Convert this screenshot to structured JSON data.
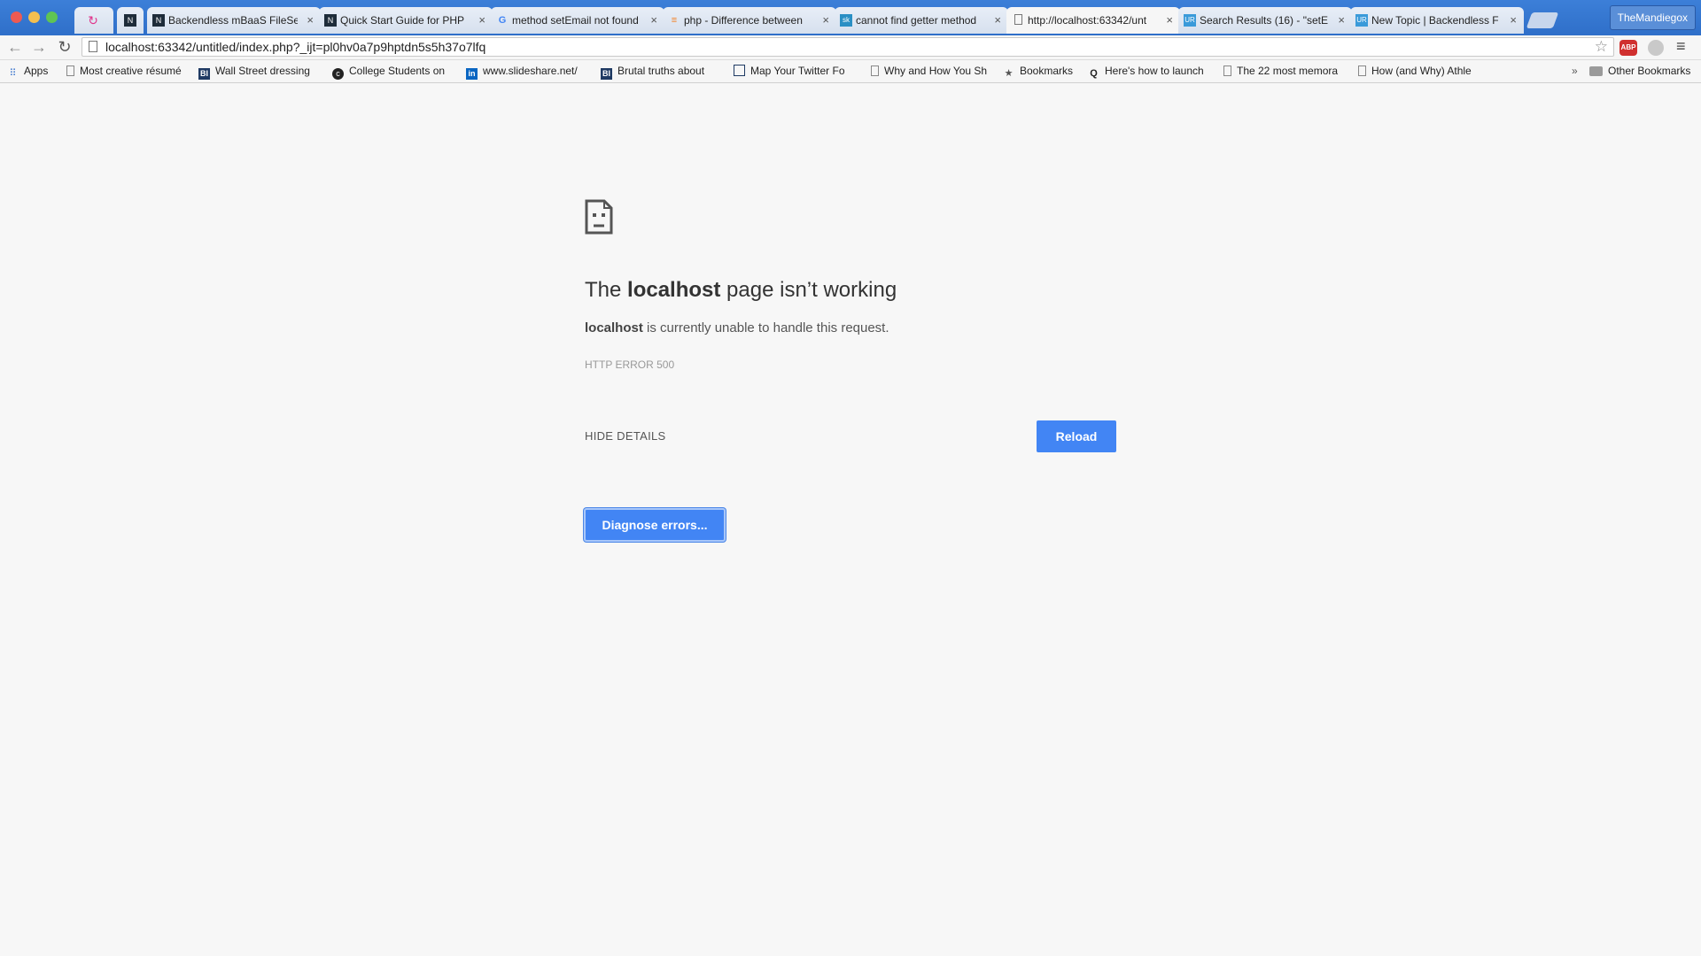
{
  "browser": {
    "tabs": [
      {
        "title": "",
        "favicon": "reload-spinner-icon",
        "active": false
      },
      {
        "title": "Backendless mBaaS FileSe",
        "favicon": "backendless-icon",
        "active": false
      },
      {
        "title": "Quick Start Guide for PHP",
        "favicon": "backendless-icon",
        "active": false
      },
      {
        "title": "method setEmail not found",
        "favicon": "google-icon",
        "active": false
      },
      {
        "title": "php - Difference between",
        "favicon": "stackoverflow-icon",
        "active": false
      },
      {
        "title": "cannot find getter method",
        "favicon": "site-icon",
        "active": false
      },
      {
        "title": "http://localhost:63342/unt",
        "favicon": "page-icon",
        "active": true
      },
      {
        "title": "Search Results (16) - \"setE",
        "favicon": "uservoice-icon",
        "active": false
      },
      {
        "title": "New Topic | Backendless F",
        "favicon": "uservoice-icon",
        "active": false
      }
    ],
    "profile_name": "TheMandiegox",
    "url": "localhost:63342/untitled/index.php?_ijt=pl0hv0a7p9hptdn5s5h37o7lfq",
    "bookmarks": [
      {
        "label": "Apps",
        "icon": "apps-grid-icon"
      },
      {
        "label": "Most creative résumé",
        "icon": "page-icon"
      },
      {
        "label": "Wall Street dressing",
        "icon": "business-insider-icon"
      },
      {
        "label": "College Students on",
        "icon": "site-icon"
      },
      {
        "label": "www.slideshare.net/",
        "icon": "linkedin-icon"
      },
      {
        "label": "Brutal truths about",
        "icon": "business-insider-icon"
      },
      {
        "label": "Map Your Twitter Fo",
        "icon": "site-icon"
      },
      {
        "label": "Why and How You Sh",
        "icon": "page-icon"
      },
      {
        "label": "Bookmarks",
        "icon": "star-icon"
      },
      {
        "label": "Here's how to launch",
        "icon": "quora-icon"
      },
      {
        "label": "The 22 most memora",
        "icon": "page-icon"
      },
      {
        "label": "How (and Why) Athle",
        "icon": "page-icon"
      }
    ],
    "overflow_chevron": "»",
    "other_bookmarks": "Other Bookmarks",
    "abp_label": "ABP"
  },
  "error_page": {
    "title_prefix": "The ",
    "title_host": "localhost",
    "title_suffix": " page isn’t working",
    "desc_host": "localhost",
    "desc_rest": " is currently unable to handle this request.",
    "error_code": "HTTP ERROR 500",
    "hide_details_label": "HIDE DETAILS",
    "reload_label": "Reload",
    "diagnose_label": "Diagnose errors..."
  },
  "colors": {
    "accent": "#4285f4",
    "tabstrip": "#2f6fc9",
    "page_bg": "#f7f7f7"
  }
}
